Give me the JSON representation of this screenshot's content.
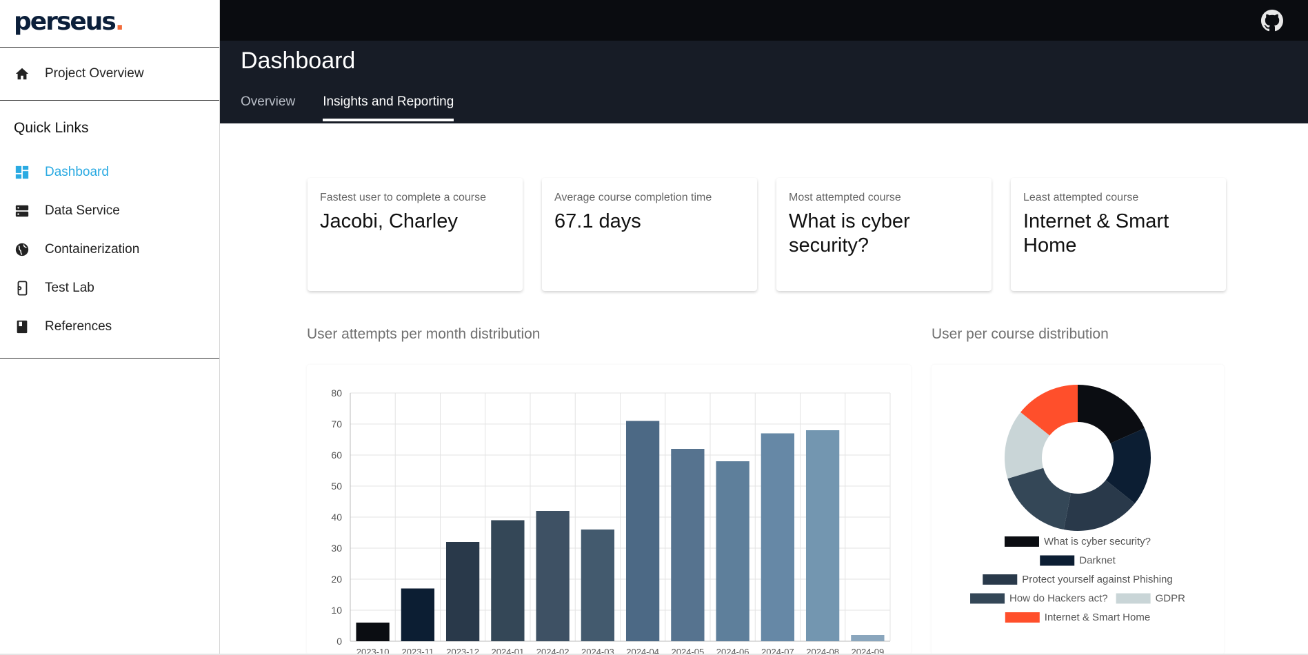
{
  "brand": {
    "name": "perseus",
    "dot": "."
  },
  "sidebar": {
    "top_item": {
      "label": "Project Overview",
      "icon": "home-icon"
    },
    "quick_links_title": "Quick Links",
    "items": [
      {
        "label": "Dashboard",
        "icon": "dashboard-icon",
        "active": true
      },
      {
        "label": "Data Service",
        "icon": "server-icon"
      },
      {
        "label": "Containerization",
        "icon": "globe-icon"
      },
      {
        "label": "Test Lab",
        "icon": "phone-settings-icon"
      },
      {
        "label": "References",
        "icon": "book-icon"
      }
    ]
  },
  "header": {
    "title": "Dashboard",
    "tabs": [
      {
        "label": "Overview",
        "active": false
      },
      {
        "label": "Insights and Reporting",
        "active": true
      }
    ]
  },
  "cards": [
    {
      "label": "Fastest user to complete a course",
      "value": "Jacobi, Charley"
    },
    {
      "label": "Average course completion time",
      "value": "67.1 days"
    },
    {
      "label": "Most attempted course",
      "value": "What is cyber security?"
    },
    {
      "label": "Least attempted course",
      "value": "Internet & Smart Home"
    }
  ],
  "sections": {
    "bar_title": "User attempts per month distribution",
    "donut_title": "User per course distribution"
  },
  "colors": {
    "accent": "#2aaae2",
    "topbar": "#0a0c10",
    "header": "#171c26",
    "logo": "#0b1f3a",
    "logo_dot": "#f26b3a"
  },
  "chart_data": [
    {
      "type": "bar",
      "categories": [
        "2023-10",
        "2023-11",
        "2023-12",
        "2024-01",
        "2024-02",
        "2024-03",
        "2024-04",
        "2024-05",
        "2024-06",
        "2024-07",
        "2024-08",
        "2024-09"
      ],
      "values": [
        6,
        17,
        32,
        39,
        42,
        36,
        71,
        62,
        58,
        67,
        68,
        2
      ],
      "colors": [
        "#0b0d12",
        "#0c1e33",
        "#29394a",
        "#344757",
        "#3e5164",
        "#435a6e",
        "#4c6985",
        "#56738f",
        "#5e7f9b",
        "#6688a6",
        "#7396b0",
        "#8aa6bd"
      ],
      "ylim": [
        0,
        80
      ],
      "yticks": [
        0,
        10,
        20,
        30,
        40,
        50,
        60,
        70,
        80
      ],
      "grid": true
    },
    {
      "type": "pie",
      "labels": [
        "What is cyber security?",
        "Darknet",
        "Protect yourself against Phishing",
        "How do Hackers act?",
        "GDPR",
        "Internet & Smart Home"
      ],
      "values": [
        18,
        17,
        17,
        17,
        15,
        14
      ],
      "colors": [
        "#0b0d12",
        "#0c1e33",
        "#29394a",
        "#344757",
        "#c9d5d7",
        "#ff4f2b"
      ],
      "donut": true,
      "legend": "bottom"
    }
  ]
}
